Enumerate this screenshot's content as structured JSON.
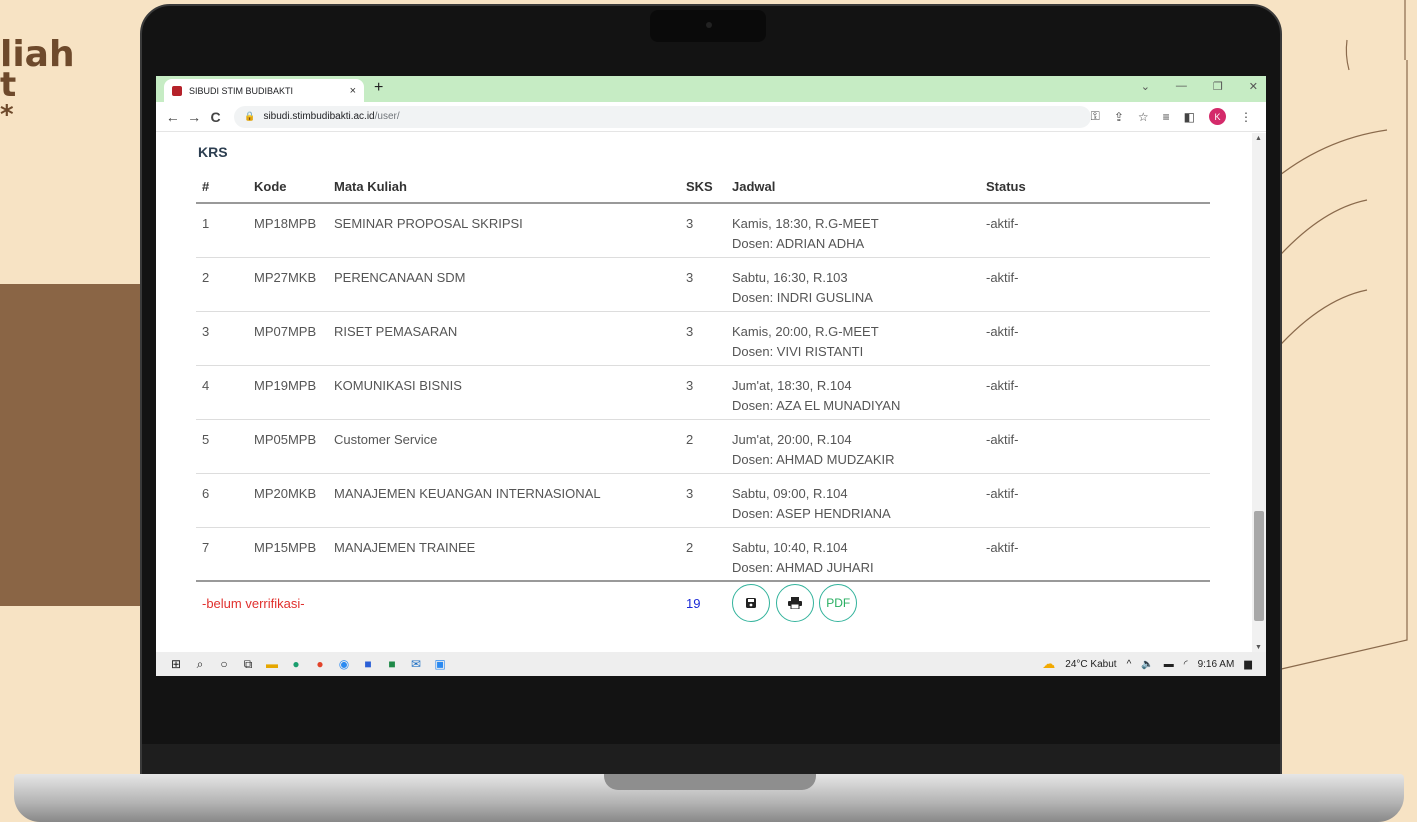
{
  "background": {
    "title_lines": [
      "liah",
      "t",
      "*"
    ]
  },
  "browser": {
    "tab_title": "SIBUDI STIM BUDIBAKTI",
    "tab_close": "×",
    "new_tab": "+",
    "window_controls": [
      "⌄",
      "—",
      "❐",
      "✕"
    ],
    "nav": {
      "back": "←",
      "forward": "→",
      "reload": "C"
    },
    "url_domain": "sibudi.stimbudibakti.ac.id",
    "url_path": "/user/",
    "profile_initial": "K"
  },
  "krs": {
    "title": "KRS",
    "headers": {
      "no": "#",
      "code": "Kode",
      "course": "Mata Kuliah",
      "sks": "SKS",
      "schedule": "Jadwal",
      "status": "Status"
    },
    "rows": [
      {
        "no": "1",
        "code": "MP18MPB",
        "course": "SEMINAR PROPOSAL SKRIPSI",
        "sks": "3",
        "schedule": "Kamis, 18:30, R.G-MEET",
        "lecturer": "Dosen: ADRIAN ADHA",
        "status": "-aktif-"
      },
      {
        "no": "2",
        "code": "MP27MKB",
        "course": "PERENCANAAN SDM",
        "sks": "3",
        "schedule": "Sabtu, 16:30, R.103",
        "lecturer": "Dosen: INDRI GUSLINA",
        "status": "-aktif-"
      },
      {
        "no": "3",
        "code": "MP07MPB",
        "course": "RISET PEMASARAN",
        "sks": "3",
        "schedule": "Kamis, 20:00, R.G-MEET",
        "lecturer": "Dosen: VIVI RISTANTI",
        "status": "-aktif-"
      },
      {
        "no": "4",
        "code": "MP19MPB",
        "course": "KOMUNIKASI BISNIS",
        "sks": "3",
        "schedule": "Jum'at, 18:30, R.104",
        "lecturer": "Dosen: AZA EL MUNADIYAN",
        "status": "-aktif-"
      },
      {
        "no": "5",
        "code": "MP05MPB",
        "course": "Customer Service",
        "sks": "2",
        "schedule": "Jum'at, 20:00, R.104",
        "lecturer": "Dosen: AHMAD MUDZAKIR",
        "status": "-aktif-"
      },
      {
        "no": "6",
        "code": "MP20MKB",
        "course": "MANAJEMEN KEUANGAN INTERNASIONAL",
        "sks": "3",
        "schedule": "Sabtu, 09:00, R.104",
        "lecturer": "Dosen: ASEP HENDRIANA",
        "status": "-aktif-"
      },
      {
        "no": "7",
        "code": "MP15MPB",
        "course": "MANAJEMEN TRAINEE",
        "sks": "2",
        "schedule": "Sabtu, 10:40, R.104",
        "lecturer": "Dosen: AHMAD JUHARI",
        "status": "-aktif-"
      }
    ],
    "verification": "-belum verrifikasi-",
    "total_sks": "19",
    "pdf_label": "PDF"
  },
  "taskbar": {
    "weather": "24°C  Kabut",
    "time": "9:16 AM"
  }
}
